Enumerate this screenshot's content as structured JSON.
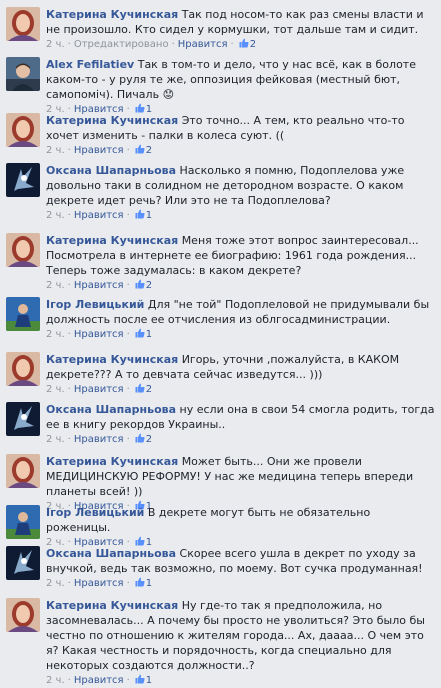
{
  "comments": [
    {
      "author": "Катерина Кучинская",
      "text": "Так под носом-то как раз смены власти и не произошло. Кто сидел у кормушки, тот дальше там и сидит.",
      "time": "2 ч.",
      "edited": "Отредактировано",
      "like": "Нравится",
      "likes": "2",
      "avatar": "kateryna"
    },
    {
      "author": "Alex Fefilatiev",
      "text": "Так в том-то и дело, что у нас всё, как в болоте каком-то - у руля те же, оппозиция фейковая (местный бют, самопоміч). Пичаль",
      "emoji": "😟",
      "time": "2 ч.",
      "like": "Нравится",
      "likes": "1",
      "avatar": "alex"
    },
    {
      "author": "Катерина Кучинская",
      "text": "Это точно... А тем, кто реально что-то хочет изменить - палки в колеса суют. ((",
      "time": "2 ч.",
      "like": "Нравится",
      "likes": "2",
      "avatar": "kateryna"
    },
    {
      "author": "Оксана Шапарньова",
      "text": "Насколько я помню, Подоплелова уже довольно таки в солидном не детородном возрасте. О каком декрете идет речь? Или это не та Подоплелова?",
      "time": "2 ч.",
      "like": "Нравится",
      "likes": "1",
      "avatar": "oksana"
    },
    {
      "author": "Катерина Кучинская",
      "text": "Меня тоже этот вопрос заинтересовал... Посмотрела в интернете ее биографию: 1961 года рождения... Теперь тоже задумалась: в каком декрете?",
      "time": "2 ч.",
      "like": "Нравится",
      "likes": "2",
      "avatar": "kateryna"
    },
    {
      "author": "Ігор Левицький",
      "text": "Для \"не той\" Подоплеловой не придумывали бы должность после ее отчисления из облгосадминистрации.",
      "time": "2 ч.",
      "like": "Нравится",
      "likes": "1",
      "avatar": "igor"
    },
    {
      "author": "Катерина Кучинская",
      "text": "Игорь, уточни ,пожалуйста, в КАКОМ декрете??? А то девчата сейчас изведутся... )))",
      "time": "2 ч.",
      "like": "Нравится",
      "likes": "2",
      "avatar": "kateryna"
    },
    {
      "author": "Оксана Шапарньова",
      "text": "ну если она в свои 54 смогла родить, тогда ее в книгу рекордов Украины..",
      "time": "2 ч.",
      "like": "Нравится",
      "likes": "2",
      "avatar": "oksana"
    },
    {
      "author": "Катерина Кучинская",
      "text": "Может быть... Они же провели МЕДИЦИНСКУЮ РЕФОРМУ! У нас же медицина теперь впереди планеты всей! ))",
      "time": "2 ч.",
      "like": "Нравится",
      "likes": "1",
      "avatar": "kateryna"
    },
    {
      "author": "Ігор Левицький",
      "text": "В декрете могут быть не обязательно роженицы.",
      "time": "2 ч.",
      "like": "Нравится",
      "likes": "1",
      "avatar": "igor"
    },
    {
      "author": "Оксана Шапарньова",
      "text": "Скорее всего ушла в декрет по уходу за внучкой, ведь так возможно, по моему. Вот сучка продуманная!",
      "time": "2 ч.",
      "like": "Нравится",
      "likes": "1",
      "avatar": "oksana"
    },
    {
      "author": "Катерина Кучинская",
      "text": "Ну где-то так я предположила, но засомневалась... А почему бы просто не уволиться? Это было бы честно по отношению к жителям города... Ах, даааа... О чем это я? Какая честность и порядочность, когда специально для некоторых создаются должности..?",
      "time": "2 ч.",
      "like": "Нравится",
      "likes": "1",
      "avatar": "kateryna"
    }
  ],
  "colors": {
    "background": "#e9ebee",
    "link": "#365899",
    "meta": "#90949c",
    "text": "#1d2129"
  }
}
